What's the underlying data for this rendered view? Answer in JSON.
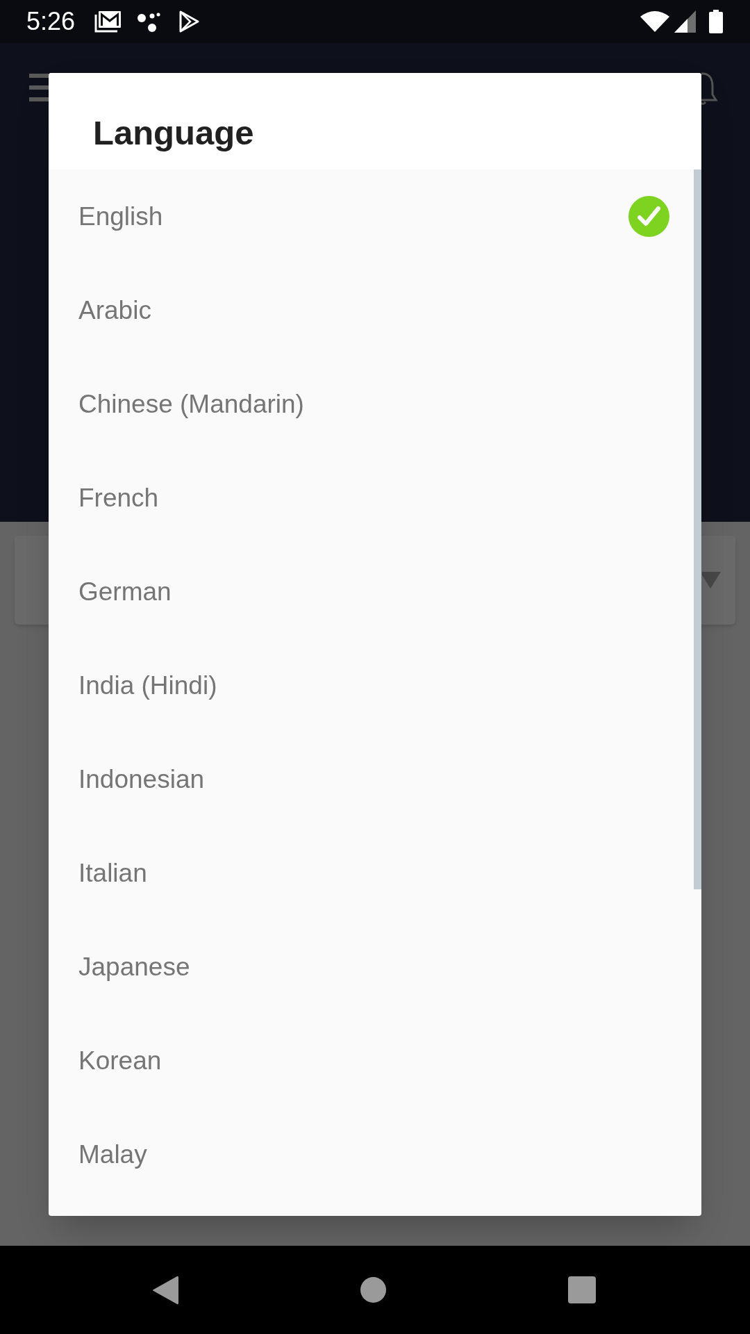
{
  "status_bar": {
    "time": "5:26"
  },
  "dialog": {
    "title": "Language",
    "items": [
      {
        "label": "English",
        "selected": true
      },
      {
        "label": "Arabic",
        "selected": false
      },
      {
        "label": "Chinese (Mandarin)",
        "selected": false
      },
      {
        "label": "French",
        "selected": false
      },
      {
        "label": "German",
        "selected": false
      },
      {
        "label": "India (Hindi)",
        "selected": false
      },
      {
        "label": "Indonesian",
        "selected": false
      },
      {
        "label": "Italian",
        "selected": false
      },
      {
        "label": "Japanese",
        "selected": false
      },
      {
        "label": "Korean",
        "selected": false
      },
      {
        "label": "Malay",
        "selected": false
      }
    ]
  }
}
